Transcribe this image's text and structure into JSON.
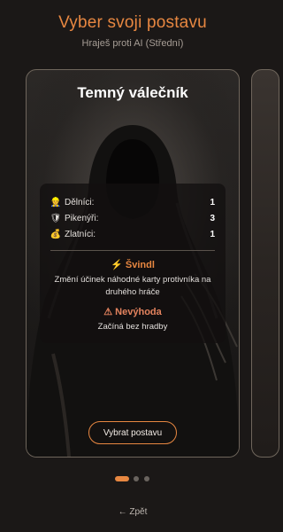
{
  "header": {
    "title": "Vyber svoji postavu",
    "subtitle": "Hraješ proti AI (Střední)"
  },
  "card": {
    "name": "Temný válečník",
    "stats": [
      {
        "icon": "worker-icon",
        "glyph": "👷",
        "label": "Dělníci:",
        "value": "1"
      },
      {
        "icon": "shield-icon",
        "glyph": "🛡",
        "label": "Pikenýři:",
        "value": "3"
      },
      {
        "icon": "money-bag-icon",
        "glyph": "💰",
        "label": "Zlatníci:",
        "value": "1"
      }
    ],
    "ability": {
      "icon": "lightning-icon",
      "glyph": "⚡",
      "title": "Švindl",
      "description": "Změní účinek náhodné karty protivníka na druhého hráče"
    },
    "drawback": {
      "icon": "warning-icon",
      "glyph": "⚠",
      "title": "Nevýhoda",
      "description": "Začíná bez hradby"
    },
    "select_label": "Vybrat postavu"
  },
  "pagination": {
    "count": 3,
    "active_index": 0
  },
  "footer": {
    "back_label": "← Zpět"
  },
  "colors": {
    "accent": "#e78741",
    "drawback": "#e4835e",
    "background": "#1b1817",
    "card_border": "#6f665c"
  }
}
